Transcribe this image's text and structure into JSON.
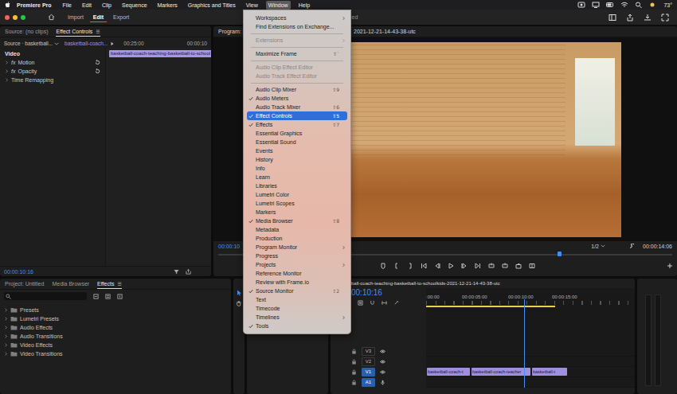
{
  "menubar": {
    "app": "Premiere Pro",
    "items": [
      {
        "label": "File",
        "selected": false
      },
      {
        "label": "Edit",
        "selected": false
      },
      {
        "label": "Clip",
        "selected": false
      },
      {
        "label": "Sequence",
        "selected": false
      },
      {
        "label": "Markers",
        "selected": false
      },
      {
        "label": "Graphics and Titles",
        "selected": false
      },
      {
        "label": "View",
        "selected": false
      },
      {
        "label": "Window",
        "selected": true
      },
      {
        "label": "Help",
        "selected": false
      }
    ],
    "temperature": "73°"
  },
  "header": {
    "tabs": [
      {
        "label": "Import",
        "selected": false
      },
      {
        "label": "Edit",
        "selected": true
      },
      {
        "label": "Export",
        "selected": false
      }
    ],
    "title": "ited"
  },
  "effect_controls": {
    "tabs": [
      {
        "label": "Source: (no clips)",
        "selected": false
      },
      {
        "label": "Effect Controls",
        "selected": true
      }
    ],
    "menu_glyph": "☰",
    "source": "Source · basketball...",
    "clip": "basketball-coach...",
    "ruler": [
      "00:25:00",
      "00:00:10"
    ],
    "clip_bar": "basketball-coach-teaching-basketball-to-school",
    "section": "Video",
    "properties": [
      {
        "badge": "fx",
        "name": "Motion",
        "expanded": false,
        "resettable": true
      },
      {
        "badge": "fx",
        "name": "Opacity",
        "expanded": false,
        "resettable": true
      },
      {
        "badge": "",
        "name": "Time Remapping",
        "expanded": false,
        "resettable": false
      }
    ],
    "timecode": "00:00:10:16"
  },
  "program": {
    "title": "Program: ba",
    "title_tail": "2021-12-21-14-43-38-utc",
    "timecode": "00:00:10",
    "zoom": "1/2",
    "duration": "00:00:14:06",
    "playhead": 0.75
  },
  "project": {
    "tabs": [
      {
        "label": "Project: Untitled",
        "selected": false
      },
      {
        "label": "Media Browser",
        "selected": false
      },
      {
        "label": "Effects",
        "selected": true
      }
    ],
    "menu_glyph": "☰",
    "folders": [
      {
        "label": "Presets",
        "expanded": false
      },
      {
        "label": "Lumetri Presets",
        "expanded": false
      },
      {
        "label": "Audio Effects",
        "expanded": false
      },
      {
        "label": "Audio Transitions",
        "expanded": false
      },
      {
        "label": "Video Effects",
        "expanded": false
      },
      {
        "label": "Video Transitions",
        "expanded": false
      }
    ]
  },
  "tools": [
    {
      "name": "selection",
      "selected": true
    },
    {
      "name": "hand",
      "selected": false
    }
  ],
  "timeline": {
    "title": "ball-coach-teaching-basketball-to-schoolkids-2021-12-21-14-43-38-utc",
    "timecode": "00:10:16",
    "ruler": [
      ":00:00",
      "00:00:05:00",
      "00:00:10:00",
      "00:00:15:00"
    ],
    "work_area": 0.62,
    "playhead": 0.47,
    "tracks": [
      {
        "label": "V3",
        "kind": "video",
        "targeted": false,
        "clips": []
      },
      {
        "label": "V2",
        "kind": "video",
        "targeted": false,
        "clips": []
      },
      {
        "label": "V1",
        "kind": "video",
        "targeted": true,
        "clips": [
          {
            "label": "basketball-coach-t"
          },
          {
            "label": "basketball-coach-teacher"
          },
          {
            "label": "basketball-t"
          }
        ]
      },
      {
        "label": "A1",
        "kind": "audio",
        "targeted": true,
        "clips": []
      }
    ]
  },
  "window_menu": {
    "items": [
      {
        "kind": "item",
        "label": "Workspaces",
        "checked": false,
        "shortcut": "",
        "submenu": true,
        "disabled": false,
        "selected": false
      },
      {
        "kind": "item",
        "label": "Find Extensions on Exchange...",
        "checked": false,
        "shortcut": "",
        "submenu": false,
        "disabled": false,
        "selected": false
      },
      {
        "kind": "separator"
      },
      {
        "kind": "item",
        "label": "Extensions",
        "checked": false,
        "shortcut": "",
        "submenu": true,
        "disabled": true,
        "selected": false
      },
      {
        "kind": "separator"
      },
      {
        "kind": "item",
        "label": "Maximize Frame",
        "checked": false,
        "shortcut": "⇧`",
        "submenu": false,
        "disabled": false,
        "selected": false
      },
      {
        "kind": "separator"
      },
      {
        "kind": "item",
        "label": "Audio Clip Effect Editor",
        "checked": false,
        "shortcut": "",
        "submenu": false,
        "disabled": true,
        "selected": false
      },
      {
        "kind": "item",
        "label": "Audio Track Effect Editor",
        "checked": false,
        "shortcut": "",
        "submenu": false,
        "disabled": true,
        "selected": false
      },
      {
        "kind": "separator"
      },
      {
        "kind": "item",
        "label": "Audio Clip Mixer",
        "checked": false,
        "shortcut": "⇧9",
        "submenu": false,
        "disabled": false,
        "selected": false
      },
      {
        "kind": "item",
        "label": "Audio Meters",
        "checked": true,
        "shortcut": "",
        "submenu": false,
        "disabled": false,
        "selected": false
      },
      {
        "kind": "item",
        "label": "Audio Track Mixer",
        "checked": false,
        "shortcut": "⇧6",
        "submenu": false,
        "disabled": false,
        "selected": false
      },
      {
        "kind": "item",
        "label": "Effect Controls",
        "checked": true,
        "shortcut": "⇧5",
        "submenu": false,
        "disabled": false,
        "selected": true
      },
      {
        "kind": "item",
        "label": "Effects",
        "checked": true,
        "shortcut": "⇧7",
        "submenu": false,
        "disabled": false,
        "selected": false
      },
      {
        "kind": "item",
        "label": "Essential Graphics",
        "checked": false,
        "shortcut": "",
        "submenu": false,
        "disabled": false,
        "selected": false
      },
      {
        "kind": "item",
        "label": "Essential Sound",
        "checked": false,
        "shortcut": "",
        "submenu": false,
        "disabled": false,
        "selected": false
      },
      {
        "kind": "item",
        "label": "Events",
        "checked": false,
        "shortcut": "",
        "submenu": false,
        "disabled": false,
        "selected": false
      },
      {
        "kind": "item",
        "label": "History",
        "checked": false,
        "shortcut": "",
        "submenu": false,
        "disabled": false,
        "selected": false
      },
      {
        "kind": "item",
        "label": "Info",
        "checked": false,
        "shortcut": "",
        "submenu": false,
        "disabled": false,
        "selected": false
      },
      {
        "kind": "item",
        "label": "Learn",
        "checked": false,
        "shortcut": "",
        "submenu": false,
        "disabled": false,
        "selected": false
      },
      {
        "kind": "item",
        "label": "Libraries",
        "checked": false,
        "shortcut": "",
        "submenu": false,
        "disabled": false,
        "selected": false
      },
      {
        "kind": "item",
        "label": "Lumetri Color",
        "checked": false,
        "shortcut": "",
        "submenu": false,
        "disabled": false,
        "selected": false
      },
      {
        "kind": "item",
        "label": "Lumetri Scopes",
        "checked": false,
        "shortcut": "",
        "submenu": false,
        "disabled": false,
        "selected": false
      },
      {
        "kind": "item",
        "label": "Markers",
        "checked": false,
        "shortcut": "",
        "submenu": false,
        "disabled": false,
        "selected": false
      },
      {
        "kind": "item",
        "label": "Media Browser",
        "checked": true,
        "shortcut": "⇧8",
        "submenu": false,
        "disabled": false,
        "selected": false
      },
      {
        "kind": "item",
        "label": "Metadata",
        "checked": false,
        "shortcut": "",
        "submenu": false,
        "disabled": false,
        "selected": false
      },
      {
        "kind": "item",
        "label": "Production",
        "checked": false,
        "shortcut": "",
        "submenu": false,
        "disabled": false,
        "selected": false
      },
      {
        "kind": "item",
        "label": "Program Monitor",
        "checked": false,
        "shortcut": "",
        "submenu": true,
        "disabled": false,
        "selected": false
      },
      {
        "kind": "item",
        "label": "Progress",
        "checked": false,
        "shortcut": "",
        "submenu": false,
        "disabled": false,
        "selected": false
      },
      {
        "kind": "item",
        "label": "Projects",
        "checked": false,
        "shortcut": "",
        "submenu": true,
        "disabled": false,
        "selected": false
      },
      {
        "kind": "item",
        "label": "Reference Monitor",
        "checked": false,
        "shortcut": "",
        "submenu": false,
        "disabled": false,
        "selected": false
      },
      {
        "kind": "item",
        "label": "Review with Frame.io",
        "checked": false,
        "shortcut": "",
        "submenu": false,
        "disabled": false,
        "selected": false
      },
      {
        "kind": "item",
        "label": "Source Monitor",
        "checked": true,
        "shortcut": "⇧2",
        "submenu": false,
        "disabled": false,
        "selected": false
      },
      {
        "kind": "item",
        "label": "Text",
        "checked": false,
        "shortcut": "",
        "submenu": false,
        "disabled": false,
        "selected": false
      },
      {
        "kind": "item",
        "label": "Timecode",
        "checked": false,
        "shortcut": "",
        "submenu": false,
        "disabled": false,
        "selected": false
      },
      {
        "kind": "item",
        "label": "Timelines",
        "checked": false,
        "shortcut": "",
        "submenu": true,
        "disabled": false,
        "selected": false
      },
      {
        "kind": "item",
        "label": "Tools",
        "checked": true,
        "shortcut": "",
        "submenu": false,
        "disabled": false,
        "selected": false
      }
    ]
  }
}
